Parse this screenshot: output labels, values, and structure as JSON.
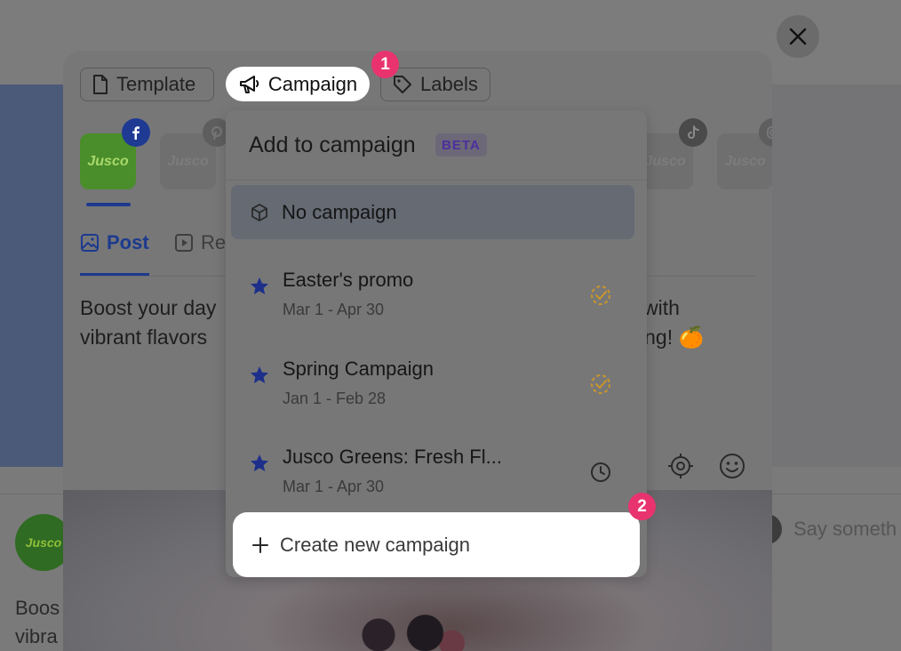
{
  "colors": {
    "accent": "#1d3a8e",
    "step_badge": "#e8336f",
    "beta_text": "#4d2f9e",
    "in_progress": "#c9962a"
  },
  "toolbar": {
    "template_label": "Template",
    "campaign_label": "Campaign",
    "labels_label": "Labels"
  },
  "steps": [
    "1",
    "2"
  ],
  "profiles": {
    "brand_text": "Jusco",
    "networks": [
      "facebook-icon",
      "pinterest-icon",
      "tiktok-icon",
      "instagram-icon"
    ]
  },
  "tabs": {
    "post_label": "Post",
    "reel_label": "Re"
  },
  "post": {
    "text_left_line1": "Boost your day",
    "text_left_line2": "vibrant flavors",
    "text_right_line1": "with",
    "text_right_line2": "ing! 🍊"
  },
  "campaign_dropdown": {
    "title": "Add to campaign",
    "badge": "BETA",
    "no_campaign_label": "No campaign",
    "campaigns": [
      {
        "name": "Easter's promo",
        "dates": "Mar 1 - Apr 30",
        "status_icon": "in-progress-icon"
      },
      {
        "name": "Spring Campaign",
        "dates": "Jan 1 - Feb 28",
        "status_icon": "in-progress-icon"
      },
      {
        "name": "Jusco Greens: Fresh Fl...",
        "dates": "Mar 1 - Apr 30",
        "status_icon": "scheduled-clock-icon"
      }
    ],
    "create_label": "Create new campaign"
  },
  "background": {
    "post_text_line1": "Boos",
    "post_text_line2": "vibra",
    "comment_placeholder": "Say someth"
  }
}
